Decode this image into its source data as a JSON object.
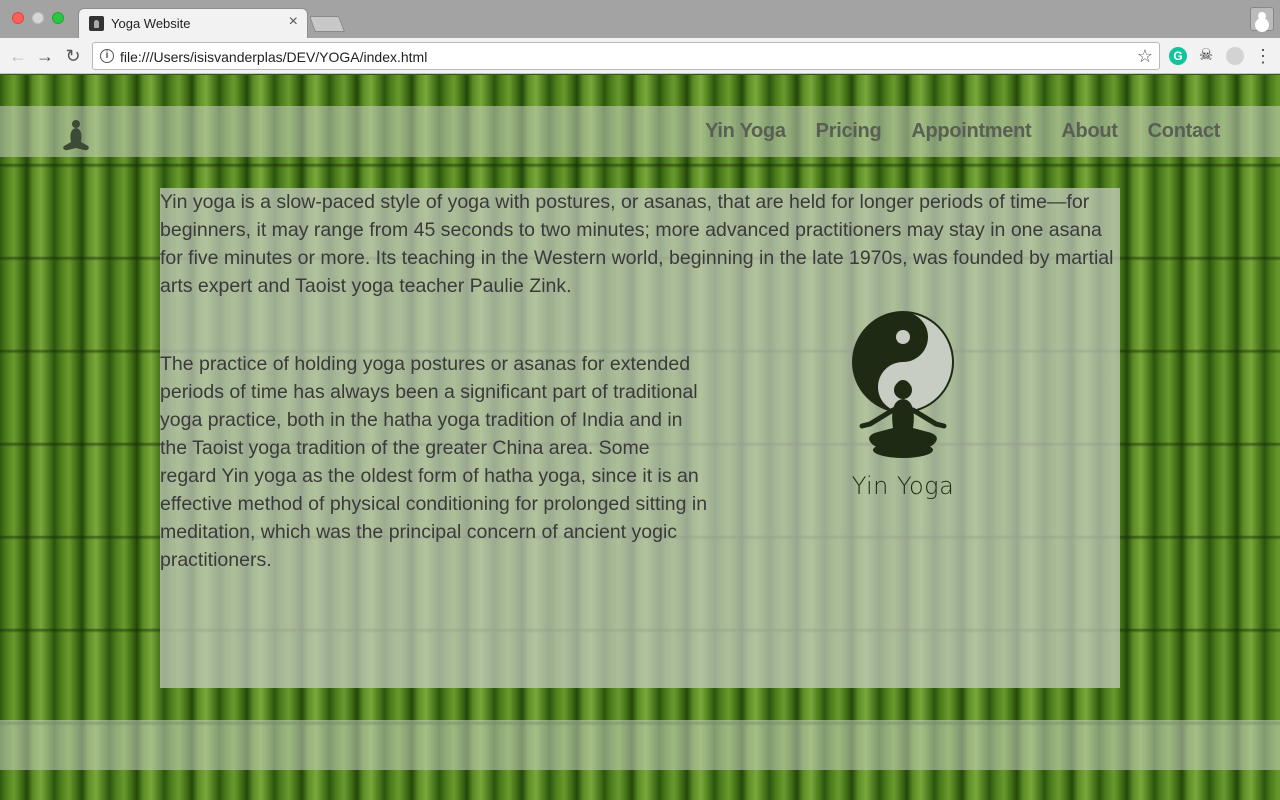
{
  "browser": {
    "tab_title": "Yoga Website",
    "tab_close": "×",
    "url": "file:///Users/isisvanderplas/DEV/YOGA/index.html",
    "extension_g": "G"
  },
  "nav": {
    "links": [
      "Yin Yoga",
      "Pricing",
      "Appointment",
      "About",
      "Contact"
    ]
  },
  "content": {
    "paragraph1": "Yin yoga is a slow-paced style of yoga with postures, or asanas, that are held for longer periods of time—for beginners, it may range from 45 seconds to two minutes; more advanced practitioners may stay in one asana for five minutes or more. Its teaching in the Western world, beginning in the late 1970s, was founded by martial arts expert and Taoist yoga teacher Paulie Zink.",
    "paragraph2": "The practice of holding yoga postures or asanas for extended periods of time has always been a significant part of traditional yoga practice, both in the hatha yoga tradition of India and in the Taoist yoga tradition of the greater China area. Some regard Yin yoga as the oldest form of hatha yoga, since it is an effective method of physical conditioning for prolonged sitting in meditation, which was the principal concern of ancient yogic practitioners.",
    "logo_caption": "Yin Yoga"
  },
  "colors": {
    "nav_link": "#5a5f55",
    "body_text": "#3a3a3a",
    "bamboo_dark": "#2f5a10",
    "bamboo_light": "#7aa83a"
  }
}
